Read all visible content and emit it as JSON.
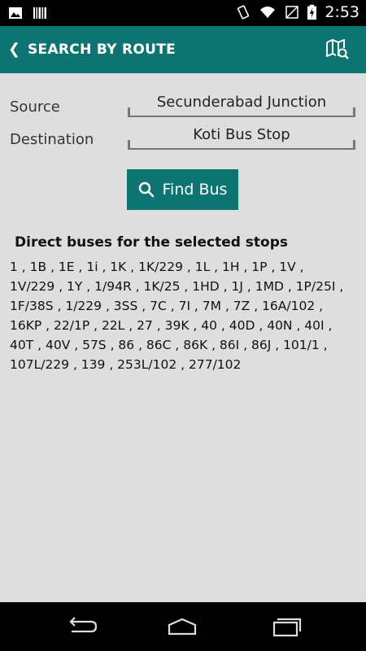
{
  "status_bar": {
    "time": "2:53",
    "left_icons": [
      "gallery-icon",
      "barcode-icon"
    ],
    "right_icons": [
      "vibrate-icon",
      "wifi-icon",
      "no-sim-icon",
      "battery-charging-icon"
    ]
  },
  "header": {
    "back_glyph": "❮",
    "title": "SEARCH BY ROUTE",
    "action_icon": "map-search-icon"
  },
  "form": {
    "source_label": "Source",
    "source_value": "Secunderabad Junction",
    "destination_label": "Destination",
    "destination_value": "Koti Bus Stop",
    "find_label": "Find Bus"
  },
  "results": {
    "heading": "Direct buses for the selected stops",
    "buses": " 1 , 1B , 1E , 1i , 1K , 1K/229 , 1L , 1H , 1P , 1V , 1V/229 , 1Y , 1/94R , 1K/25 , 1HD , 1J , 1MD , 1P/25I , 1F/38S , 1/229 , 3SS , 7C , 7I , 7M , 7Z , 16A/102 , 16KP , 22/1P , 22L , 27 , 39K , 40 , 40D , 40N , 40I , 40T , 40V , 57S , 86 , 86C , 86K , 86I , 86J , 101/1 , 107L/229 , 139 , 253L/102 , 277/102"
  },
  "navigation": {
    "buttons": [
      "back-icon",
      "home-icon",
      "recents-icon"
    ]
  },
  "colors": {
    "accent": "#0e7471",
    "background": "#dedede"
  }
}
